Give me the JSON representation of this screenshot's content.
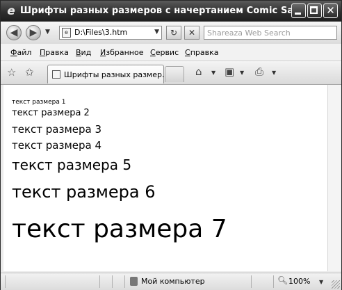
{
  "window": {
    "title": "Шрифты разных размеров с начертанием Comic Sans MS - ..."
  },
  "address_bar": {
    "url": "D:\\Files\\3.htm",
    "search_placeholder": "Shareaza Web Search"
  },
  "menu": {
    "items": [
      {
        "u": "Ф",
        "rest": "айл"
      },
      {
        "u": "П",
        "rest": "равка"
      },
      {
        "u": "В",
        "rest": "ид"
      },
      {
        "u": "И",
        "rest": "збранное"
      },
      {
        "u": "С",
        "rest": "ервис"
      },
      {
        "u": "С",
        "rest": "правка"
      }
    ]
  },
  "tab": {
    "label": "Шрифты разных размер..."
  },
  "content": {
    "lines": [
      "текст размера 1",
      "текст размера 2",
      "текст размера 3",
      "текст размера 4",
      "текст размера 5",
      "текст размера 6",
      "текст размера 7"
    ]
  },
  "status": {
    "zone": "Мой компьютер",
    "zoom": "100%"
  },
  "icons": {
    "app": "ie-icon",
    "back": "back-arrow-icon",
    "forward": "forward-arrow-icon",
    "refresh": "refresh-icon",
    "stop": "stop-icon",
    "favorites": "favorites-star-icon",
    "add_favorite": "add-favorites-icon",
    "home": "home-icon",
    "feeds": "feeds-icon",
    "print": "print-icon"
  }
}
